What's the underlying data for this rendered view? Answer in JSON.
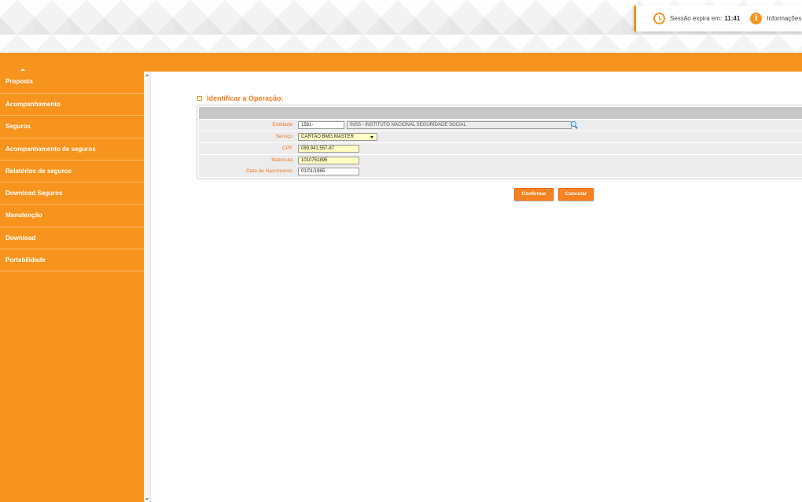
{
  "header": {
    "session_label": "Sessão expira em:",
    "session_time": "11:41",
    "info_label": "Informações"
  },
  "sidebar": {
    "items": [
      {
        "label": "Proposta"
      },
      {
        "label": "Acompanhamento"
      },
      {
        "label": "Seguros"
      },
      {
        "label": "Acompanhamento de seguros"
      },
      {
        "label": "Relatórios de seguros"
      },
      {
        "label": "Download Seguros"
      },
      {
        "label": "Manutenção"
      },
      {
        "label": "Download"
      },
      {
        "label": "Portabilidade"
      }
    ]
  },
  "main": {
    "section_title": "Identificar a Operação:",
    "form": {
      "entidade": {
        "label": "Entidade",
        "code": "1581-",
        "description": "INSS - INSTITUTO NACIONAL SEGURIDADE SOCIAL"
      },
      "servico": {
        "label": "Serviço",
        "value": "CARTÃO BMG MASTER"
      },
      "cpf": {
        "label": "CPF",
        "value": "089.941.557-87"
      },
      "matricula": {
        "label": "Matrícula",
        "value": "1010751895"
      },
      "nascimento": {
        "label": "Data de Nascimento",
        "value": "01/01/1965"
      }
    },
    "buttons": {
      "confirm": "Confirmar",
      "cancel": "Cancelar"
    }
  },
  "colors": {
    "accent": "#f7941d",
    "label": "#ea7a2a",
    "highlight_field": "#ffffc4"
  }
}
